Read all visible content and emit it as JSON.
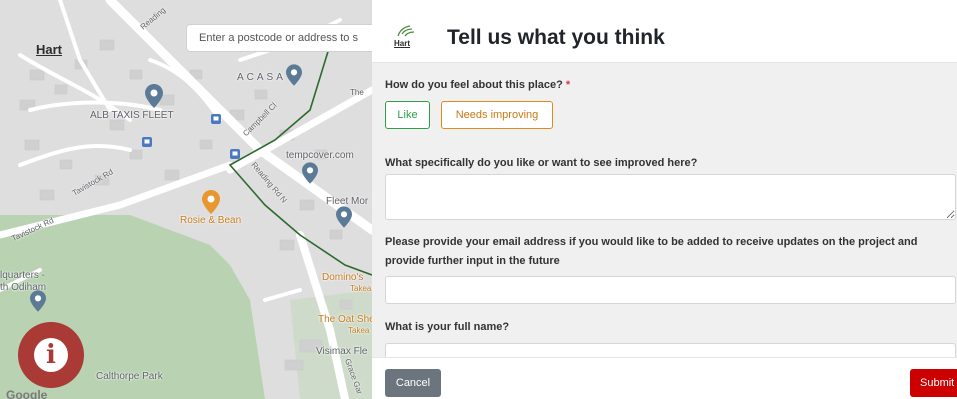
{
  "map": {
    "logo_text": "Hart",
    "search_placeholder": "Enter a postcode or address to s",
    "labels": {
      "reading": "Reading",
      "acasa": "ACASA",
      "alb_taxis": "ALB TAXIS FLEET",
      "the": "The",
      "campbell": "Campbell Cl",
      "tempcover": "tempcover.com",
      "fleet_mor": "Fleet Mor",
      "reading_rd_n": "Reading Rd N",
      "tavistock1": "Tavistock Rd",
      "tavistock2": "Tavistock Rd",
      "rosie_bean": "Rosie & Bean",
      "quarters": "lquarters -",
      "odiham": "th Odiham",
      "dominos": "Domino's",
      "takea": "Takea",
      "oat_she": "The Oat She",
      "takea2": "Takea",
      "visimax": "Visimax Fle",
      "calthorpe": "Calthorpe Park",
      "grace": "Grace Gar"
    },
    "google_mark": "Google",
    "info_glyph": "i"
  },
  "panel": {
    "logo_text": "Hart",
    "title": "Tell us what you think",
    "q1": {
      "label": "How do you feel about this place?",
      "required_mark": "*"
    },
    "choices": {
      "like": "Like",
      "needs_improving": "Needs improving"
    },
    "q2": {
      "label": "What specifically do you like or want to see improved here?"
    },
    "q3": {
      "label": "Please provide your email address if you would like to be added to receive updates on the project and provide further input in the future"
    },
    "q4": {
      "label": "What is your full name?"
    },
    "footer": {
      "cancel": "Cancel",
      "submit": "Submit"
    }
  },
  "colors": {
    "like": "#2e9e48",
    "needs_improving": "#e08a1b",
    "submit": "#cc0000",
    "cancel": "#6c757d",
    "info_button": "#a93a36",
    "required": "#dc3545"
  }
}
